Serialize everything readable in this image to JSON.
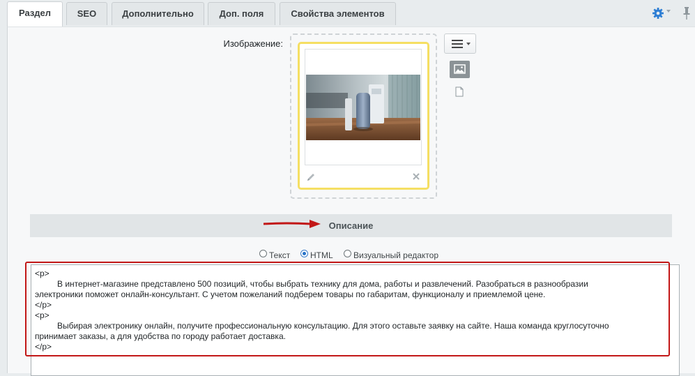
{
  "tabs": [
    {
      "label": "Раздел",
      "active": true
    },
    {
      "label": "SEO",
      "active": false
    },
    {
      "label": "Дополнительно",
      "active": false
    },
    {
      "label": "Доп. поля",
      "active": false
    },
    {
      "label": "Свойства элементов",
      "active": false
    }
  ],
  "toolbar": {
    "settings_icon": "gear-icon",
    "pin_icon": "pin-icon"
  },
  "image_field": {
    "label": "Изображение:",
    "edit_icon": "pencil-icon",
    "remove_icon": "close-icon",
    "menu_icon": "hamburger-menu-icon",
    "mode_icons": [
      "image-icon",
      "file-icon"
    ]
  },
  "section": {
    "title": "Описание"
  },
  "editor": {
    "modes": [
      {
        "label": "Текст",
        "checked": false
      },
      {
        "label": "HTML",
        "checked": true
      },
      {
        "label": "Визуальный редактор",
        "checked": false
      }
    ],
    "lines": [
      "<p>",
      "В интернет-магазине представлено 500 позиций, чтобы выбрать технику для дома, работы и развлечений. Разобраться в разнообразии",
      "электроники поможет онлайн-консультант. С учетом пожеланий подберем товары по габаритам, функционалу и приемлемой цене.",
      "</p>",
      "<p>",
      "Выбирая электронику онлайн, получите профессиональную консультацию. Для этого оставьте заявку на сайте. Наша команда круглосуточно",
      "принимает заказы, а для удобства по городу работает доставка.",
      "</p>"
    ]
  },
  "colors": {
    "accent": "#2873c8",
    "highlight": "#c21717",
    "image_frame": "#f5df63"
  }
}
